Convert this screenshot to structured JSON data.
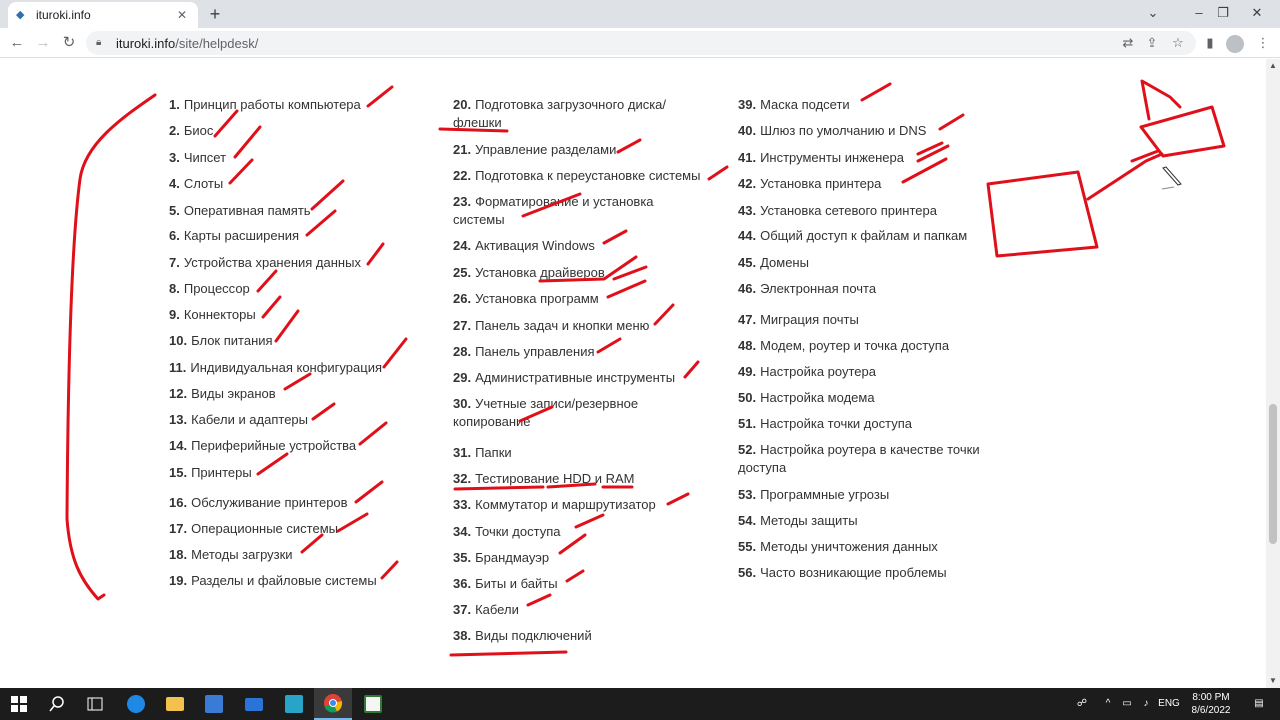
{
  "browser": {
    "tab_title": "ituroki.info",
    "new_tab_label": "+",
    "url_host": "ituroki.info",
    "url_path": "/site/helpdesk/",
    "window_controls": [
      "⌄",
      "–",
      "❐",
      "✕"
    ]
  },
  "columns": [
    [
      {
        "num": "1.",
        "text": "Принцип работы компьютера"
      },
      {
        "num": "2.",
        "text": "Биос"
      },
      {
        "num": "3.",
        "text": "Чипсет"
      },
      {
        "num": "4.",
        "text": "Слоты"
      },
      {
        "num": "5.",
        "text": "Оперативная память"
      },
      {
        "num": "6.",
        "text": "Карты расширения"
      },
      {
        "num": "7.",
        "text": "Устройства хранения данных"
      },
      {
        "num": "8.",
        "text": "Процессор"
      },
      {
        "num": "9.",
        "text": "Коннекторы"
      },
      {
        "num": "10.",
        "text": "Блок питания"
      },
      {
        "num": "11.",
        "text": "Индивидуальная конфигурация"
      },
      {
        "num": "12.",
        "text": "Виды экранов"
      },
      {
        "num": "13.",
        "text": "Кабели и адаптеры"
      },
      {
        "num": "14.",
        "text": "Периферийные устройства"
      },
      {
        "num": "15.",
        "text": "Принтеры"
      },
      {
        "num": "16.",
        "text": "Обслуживание принтеров"
      },
      {
        "num": "17.",
        "text": "Операционные системы"
      },
      {
        "num": "18.",
        "text": "Методы загрузки"
      },
      {
        "num": "19.",
        "text": "Разделы и файловые системы"
      }
    ],
    [
      {
        "num": "20.",
        "text": "Подготовка загрузочного диска/ флешки"
      },
      {
        "num": "21.",
        "text": "Управление разделами"
      },
      {
        "num": "22.",
        "text": "Подготовка к переустановке системы"
      },
      {
        "num": "23.",
        "text": "Форматирование и установка системы"
      },
      {
        "num": "24.",
        "text": "Активация Windows"
      },
      {
        "num": "25.",
        "text": "Установка драйверов"
      },
      {
        "num": "26.",
        "text": "Установка программ"
      },
      {
        "num": "27.",
        "text": "Панель задач и кнопки меню"
      },
      {
        "num": "28.",
        "text": "Панель управления"
      },
      {
        "num": "29.",
        "text": "Административные инструменты"
      },
      {
        "num": "30.",
        "text": "Учетные записи/резервное копирование"
      },
      {
        "num": "31.",
        "text": "Папки"
      },
      {
        "num": "32.",
        "text": "Тестирование HDD и RAM"
      },
      {
        "num": "33.",
        "text": "Коммутатор и маршрутизатор"
      },
      {
        "num": "34.",
        "text": "Точки доступа"
      },
      {
        "num": "35.",
        "text": "Брандмауэр"
      },
      {
        "num": "36.",
        "text": "Биты и байты"
      },
      {
        "num": "37.",
        "text": "Кабели"
      },
      {
        "num": "38.",
        "text": "Виды подключений"
      }
    ],
    [
      {
        "num": "39.",
        "text": "Маска подсети"
      },
      {
        "num": "40.",
        "text": "Шлюз по умолчанию и DNS"
      },
      {
        "num": "41.",
        "text": "Инструменты инженера"
      },
      {
        "num": "42.",
        "text": "Установка принтера"
      },
      {
        "num": "43.",
        "text": "Установка сетевого принтера"
      },
      {
        "num": "44.",
        "text": "Общий доступ к файлам и папкам"
      },
      {
        "num": "45.",
        "text": "Домены"
      },
      {
        "num": "46.",
        "text": "Электронная почта"
      },
      {
        "num": "47.",
        "text": "Миграция почты"
      },
      {
        "num": "48.",
        "text": "Модем, роутер и точка доступа"
      },
      {
        "num": "49.",
        "text": "Настройка роутера"
      },
      {
        "num": "50.",
        "text": "Настройка модема"
      },
      {
        "num": "51.",
        "text": "Настройка точки доступа"
      },
      {
        "num": "52.",
        "text": "Настройка роутера в качестве точки доступа"
      },
      {
        "num": "53.",
        "text": "Программные угрозы"
      },
      {
        "num": "54.",
        "text": "Методы защиты"
      },
      {
        "num": "55.",
        "text": "Методы уничтожения данных"
      },
      {
        "num": "56.",
        "text": "Часто возникающие проблемы"
      }
    ]
  ],
  "colors": {
    "annotation_ink": "#e0101a",
    "text": "#333333"
  },
  "taskbar": {
    "tray_language": "ENG",
    "time": "8:00 PM",
    "date": "8/6/2022"
  }
}
